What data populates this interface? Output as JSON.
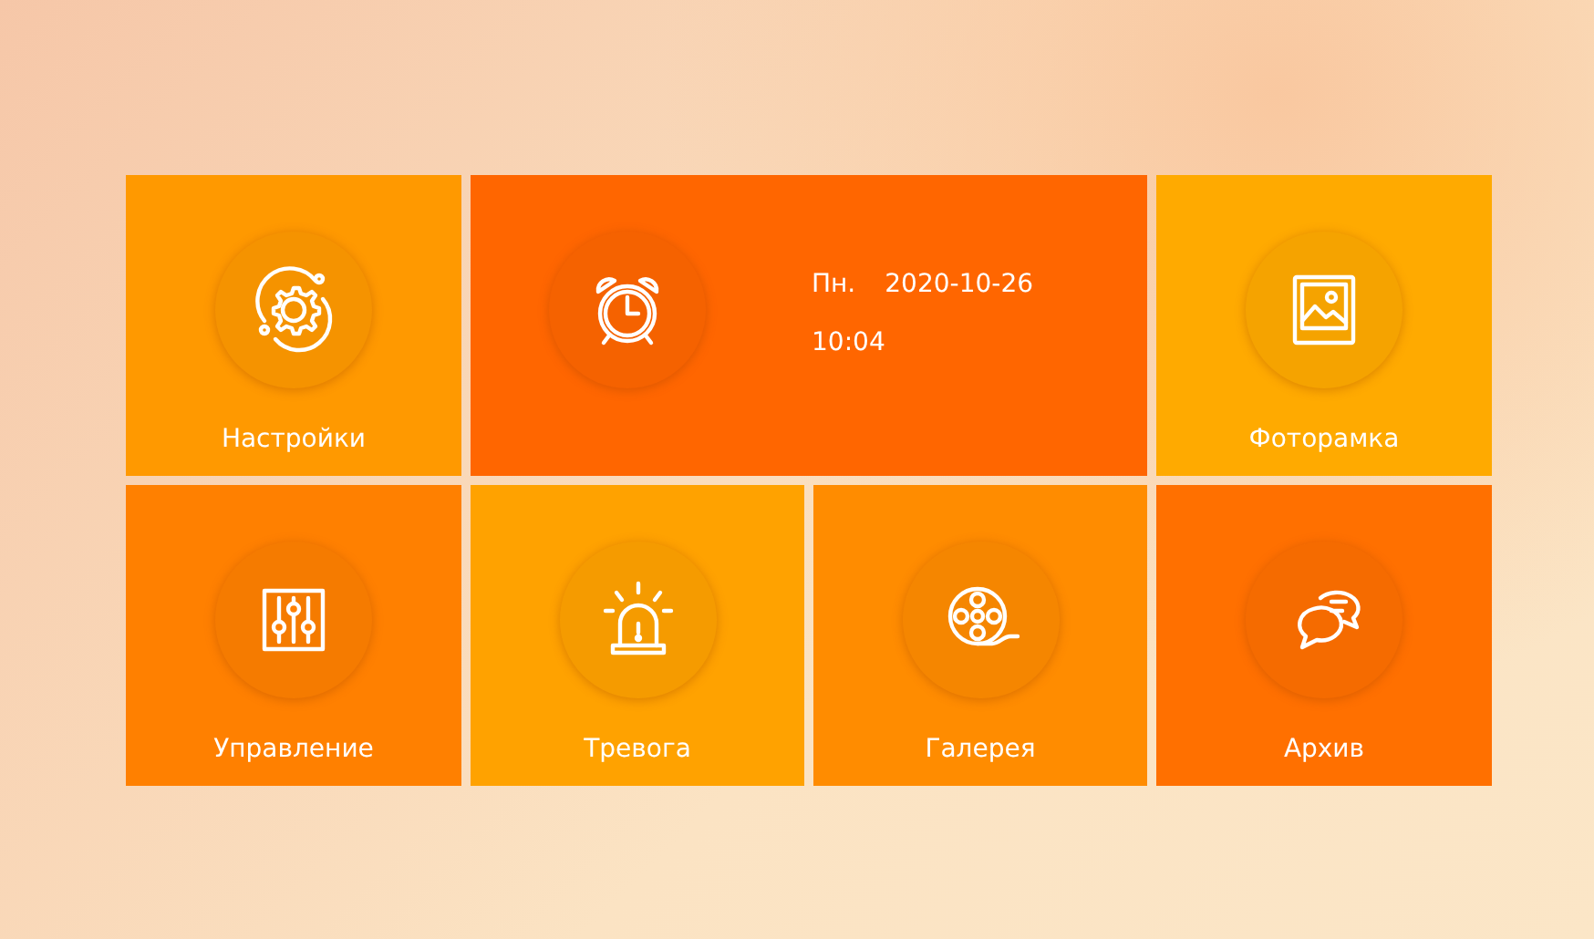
{
  "tiles": [
    {
      "kind": "launcher",
      "label": "Настройки",
      "color": "#ff9900"
    },
    {
      "kind": "clock",
      "day": "Пн.",
      "date": "2020-10-26",
      "time": "10:04",
      "color": "#ff6600"
    },
    {
      "kind": "launcher",
      "label": "Фоторамка",
      "color": "#ffaa00"
    },
    {
      "kind": "launcher",
      "label": "Управление",
      "color": "#ff8000"
    },
    {
      "kind": "launcher",
      "label": "Тревога",
      "color": "#ffa200"
    },
    {
      "kind": "launcher",
      "label": "Галерея",
      "color": "#ff8c00"
    },
    {
      "kind": "launcher",
      "label": "Архив",
      "color": "#ff7000"
    }
  ]
}
